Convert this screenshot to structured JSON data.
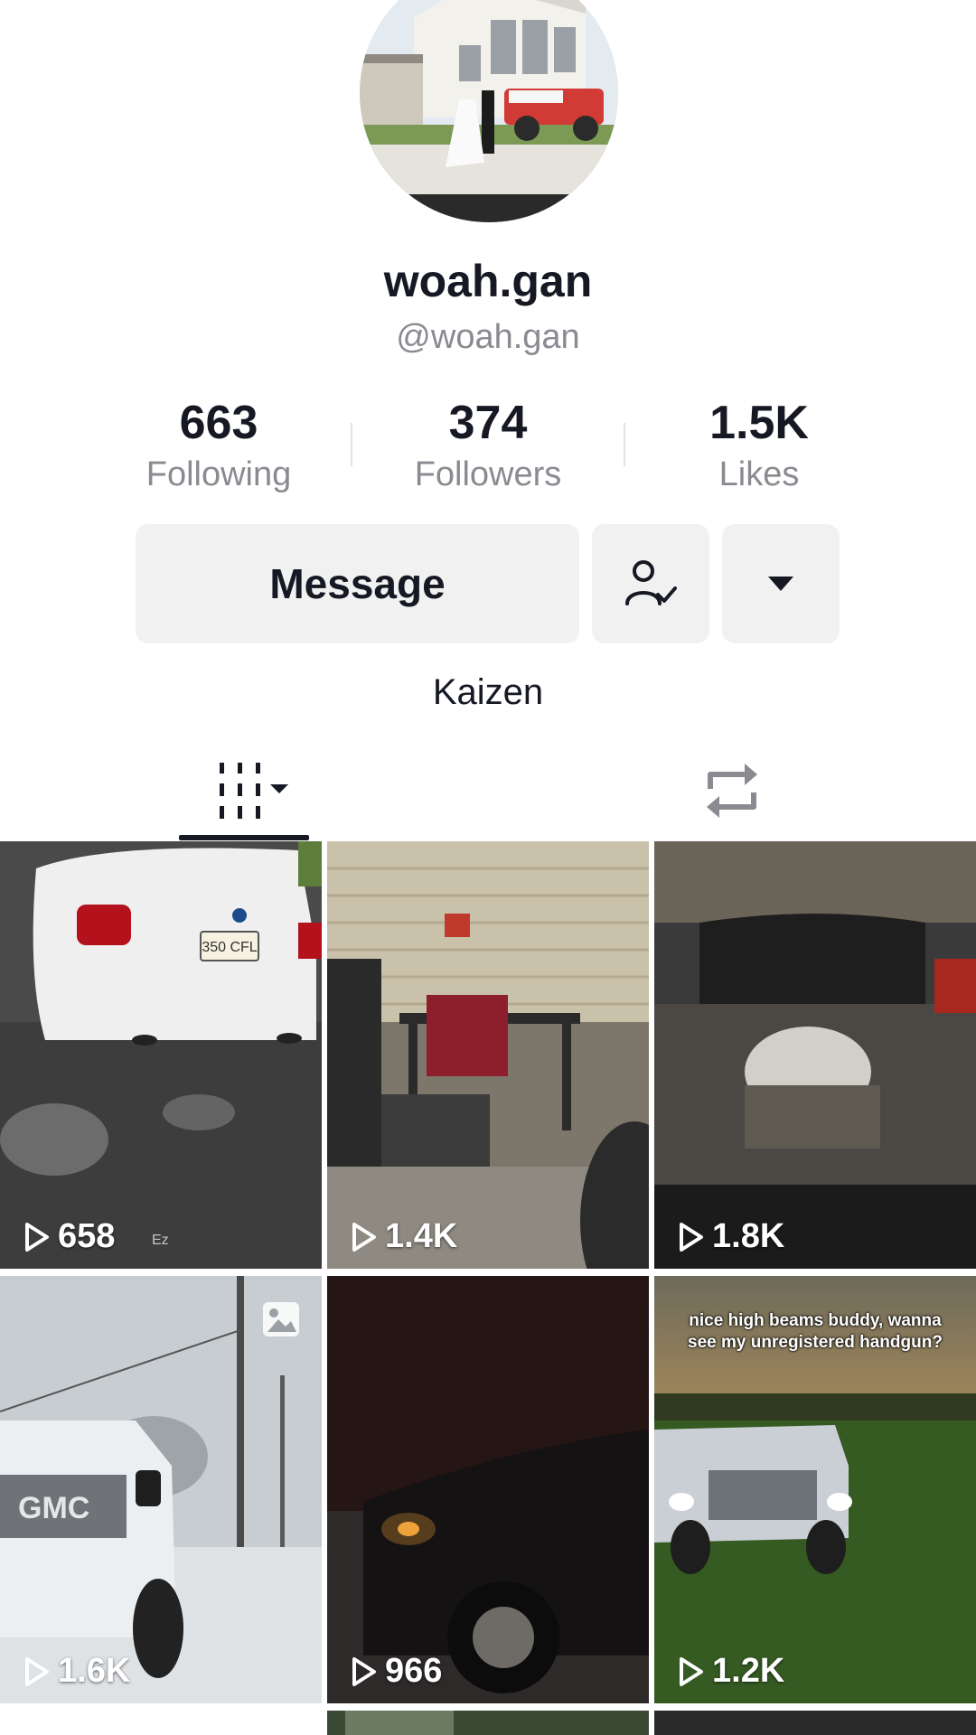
{
  "profile": {
    "display_name": "woah.gan",
    "handle": "@woah.gan",
    "bio": "Kaizen"
  },
  "stats": [
    {
      "value": "663",
      "label": "Following"
    },
    {
      "value": "374",
      "label": "Followers"
    },
    {
      "value": "1.5K",
      "label": "Likes"
    }
  ],
  "actions": {
    "message_label": "Message",
    "follow_icon": "user-check-icon",
    "more_icon": "caret-down-icon"
  },
  "tabs": [
    {
      "name": "videos",
      "icon": "videos-grid-icon",
      "selected": true
    },
    {
      "name": "reposts",
      "icon": "repost-icon",
      "selected": false
    }
  ],
  "videos": [
    {
      "views": "658",
      "watermark": "Ez",
      "caption": ""
    },
    {
      "views": "1.4K",
      "caption": ""
    },
    {
      "views": "1.8K",
      "caption": ""
    },
    {
      "views": "1.6K",
      "caption": "",
      "photo_icon": "photo-icon"
    },
    {
      "views": "966",
      "caption": ""
    },
    {
      "views": "1.2K",
      "caption": "nice high beams buddy, wanna see my unregistered handgun?"
    }
  ],
  "colors": {
    "text_primary": "#161823",
    "text_secondary": "#8a8b91",
    "button_bg": "#f1f1f2"
  }
}
